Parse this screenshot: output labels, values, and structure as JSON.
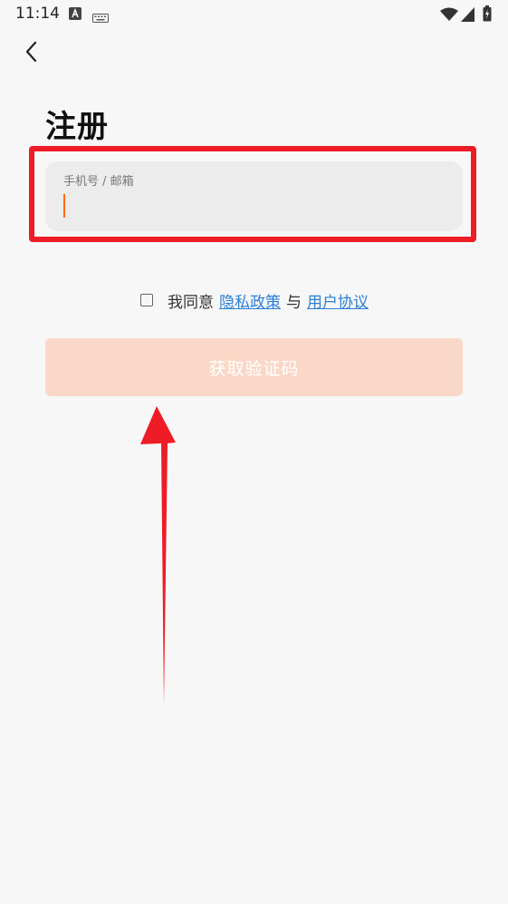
{
  "status_bar": {
    "time": "11:14",
    "icons": [
      "a-notification-icon",
      "keyboard-icon",
      "wifi-icon",
      "signal-icon",
      "battery-icon"
    ]
  },
  "nav": {
    "back_icon": "chevron-left-icon"
  },
  "page": {
    "title": "注册"
  },
  "form": {
    "account_label": "手机号 / 邮箱",
    "account_value": "",
    "agree_prefix": "我同意",
    "privacy_link": "隐私政策",
    "agree_and": "与",
    "terms_link": "用户协议",
    "agree_checked": false,
    "submit_label": "获取验证码"
  },
  "colors": {
    "accent": "#ff6a00",
    "button_disabled": "#fad8c7",
    "link": "#2a7fd4",
    "annotation": "#ee1c27"
  }
}
